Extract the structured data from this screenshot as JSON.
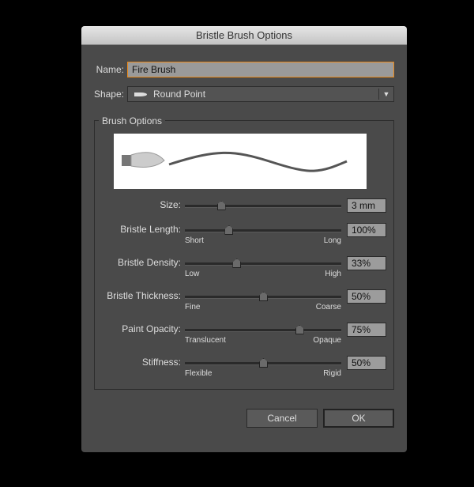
{
  "dialog": {
    "title": "Bristle Brush Options"
  },
  "name": {
    "label": "Name:",
    "value": "Fire Brush"
  },
  "shape": {
    "label": "Shape:",
    "value": "Round Point",
    "icon": "round-point-brush-icon"
  },
  "group": {
    "legend": "Brush Options"
  },
  "sliders": [
    {
      "label": "Size:",
      "value": "3 mm",
      "fraction": 0.23,
      "min_label": "",
      "max_label": ""
    },
    {
      "label": "Bristle Length:",
      "value": "100%",
      "fraction": 0.28,
      "min_label": "Short",
      "max_label": "Long"
    },
    {
      "label": "Bristle Density:",
      "value": "33%",
      "fraction": 0.33,
      "min_label": "Low",
      "max_label": "High"
    },
    {
      "label": "Bristle Thickness:",
      "value": "50%",
      "fraction": 0.5,
      "min_label": "Fine",
      "max_label": "Coarse"
    },
    {
      "label": "Paint Opacity:",
      "value": "75%",
      "fraction": 0.73,
      "min_label": "Translucent",
      "max_label": "Opaque"
    },
    {
      "label": "Stiffness:",
      "value": "50%",
      "fraction": 0.5,
      "min_label": "Flexible",
      "max_label": "Rigid"
    }
  ],
  "buttons": {
    "cancel": "Cancel",
    "ok": "OK"
  },
  "colors": {
    "focus": "#e8891c",
    "panel": "#4a4a4a"
  }
}
